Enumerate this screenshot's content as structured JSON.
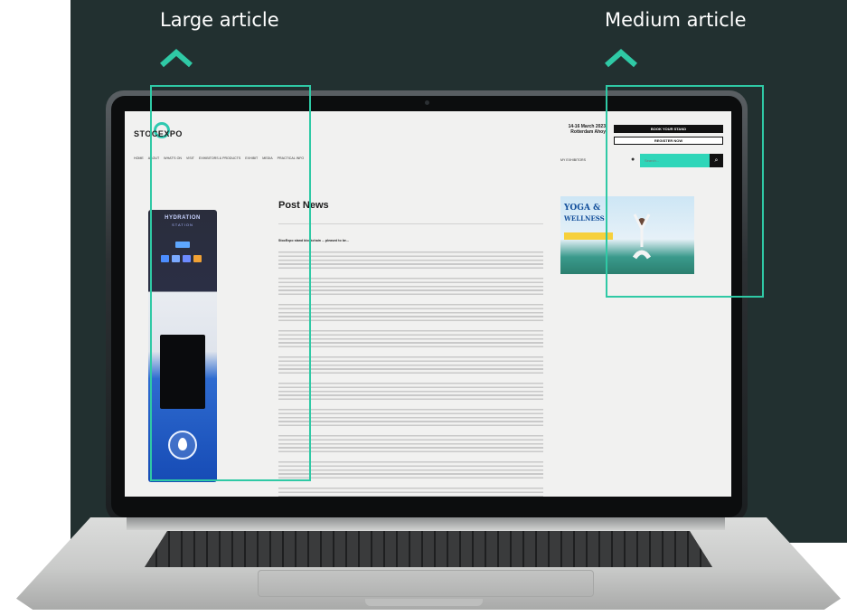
{
  "callouts": {
    "large": {
      "label": "Large article"
    },
    "medium": {
      "label": "Medium article"
    }
  },
  "colors": {
    "panel_background": "#223030",
    "accent": "#2fc9a5",
    "site_accent": "#2fd6b9"
  },
  "site": {
    "logo": "STOCEXPO",
    "event": {
      "dates": "14-16 March 2023",
      "venue": "Rotterdam Ahoy"
    },
    "buttons": {
      "book_stand": "BOOK YOUR STAND",
      "register": "REGISTER NOW"
    },
    "nav": [
      "HOME",
      "ABOUT",
      "WHAT'S ON",
      "VISIT",
      "EXHIBITORS & PRODUCTS",
      "EXHIBIT",
      "MEDIA",
      "PRACTICAL INFO"
    ],
    "exhibitors_link": "MY EXHIBITORS",
    "search": {
      "placeholder": "Search..."
    },
    "post": {
      "title": "Post News",
      "lead": "StocExpo stand blockchain ... pleased to be...",
      "paragraph_count": 10
    },
    "product_image": {
      "title": "HYDRATION",
      "subtitle": "STATION"
    },
    "ad": {
      "title_line1": "YOGA &",
      "title_line2": "WELLNESS"
    }
  }
}
